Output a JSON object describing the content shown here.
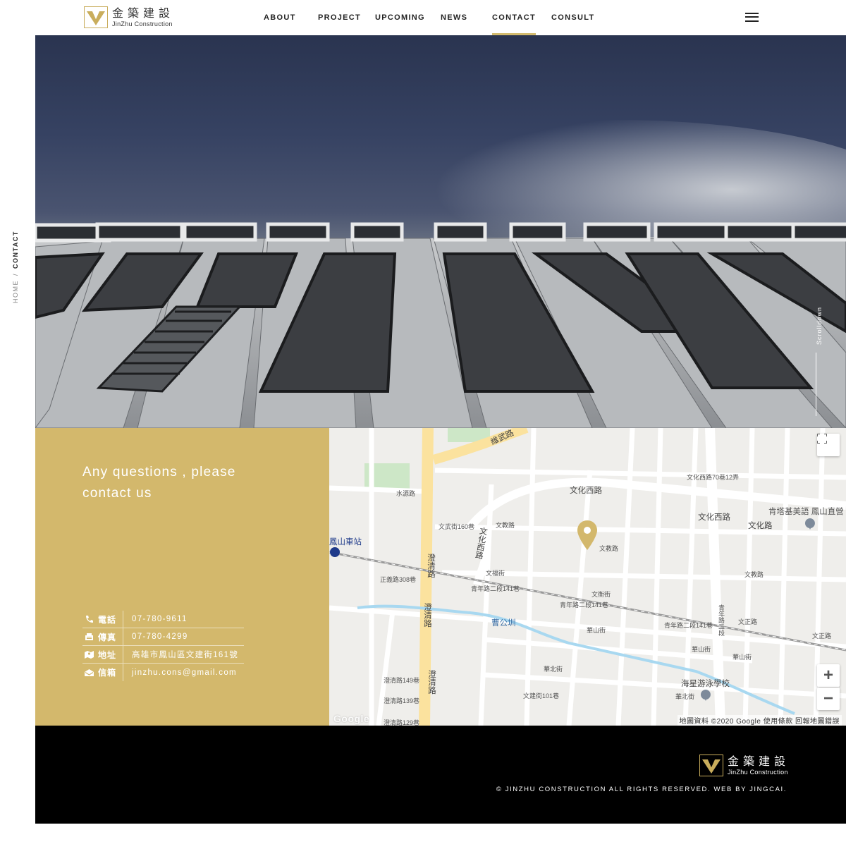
{
  "brand": {
    "name_cn": "金築建設",
    "name_en": "JinZhu Construction",
    "accent_color": "#d3b86c"
  },
  "nav": {
    "items": [
      {
        "label": "ABOUT"
      },
      {
        "label": "PROJECT"
      },
      {
        "label": "UPCOMING"
      },
      {
        "label": "NEWS"
      },
      {
        "label": "CONTACT",
        "active": true
      },
      {
        "label": "CONSULT"
      }
    ],
    "menu_icon": "hamburger-menu-icon"
  },
  "breadcrumb": {
    "home": "HOME",
    "separator": "/",
    "current": "CONTACT"
  },
  "hero": {
    "scrolldown_label": "Scrolldown"
  },
  "contact": {
    "heading": "Any questions , please contact us",
    "rows": [
      {
        "icon": "phone-icon",
        "label": "電話",
        "value": "07-780-9611"
      },
      {
        "icon": "fax-icon",
        "label": "傳真",
        "value": "07-780-4299"
      },
      {
        "icon": "map-icon",
        "label": "地址",
        "value": "高雄市鳳山區文建街161號"
      },
      {
        "icon": "mail-icon",
        "label": "信箱",
        "value": "jinzhu.cons@gmail.com"
      }
    ]
  },
  "map": {
    "labels": {
      "wenhua_w1": "文化西路",
      "wenhua_w2": "文化西路",
      "wenhua_rd": "文化路",
      "wenjiao": "文教路",
      "wenjiao2": "文教路",
      "wenjiao3": "文教路",
      "wenfu": "文福街",
      "wenwu": "文武街160巷",
      "wenhua_70": "文化西路70巷12弄",
      "qingnian": "青年路二段141巷",
      "qingnian2": "青年路二段141巷",
      "qingnian3": "青年路二段141巷",
      "zhengyi": "正義路308巷",
      "chengqing_149": "澄清路149巷",
      "chengqing_139": "澄清路139巷",
      "chengqing_129": "澄清路129巷",
      "shuiyuan": "水源路",
      "huashan": "華山街",
      "huashan2": "華山街",
      "huashan3": "華山街",
      "huabei": "華北街",
      "huabei2": "華北街",
      "wenjian_101": "文建街101巷",
      "wenzheng": "文正路",
      "wenzheng2": "文正路",
      "wenheng": "文衡街",
      "caogongzhen": "曹公圳",
      "station": "鳳山車站",
      "school": "海星游泳學校",
      "english": "肯塔基美語 鳳山直營",
      "weiwu": "維武路",
      "chengqing_v": "澄清路",
      "chengqing_v2": "澄清路",
      "chengqing_v3": "澄清路",
      "wenhua_v": "文化西路",
      "qingnian_v": "青年路二段"
    },
    "attribution": "地圖資料 ©2020 Google   使用條款   回報地圖錯誤",
    "google": "Google",
    "zoom_in": "+",
    "zoom_out": "−",
    "fullscreen_icon": "fullscreen-icon",
    "pin_color": "#d3b86c"
  },
  "footer": {
    "copyright": "© JINZHU CONSTRUCTION ALL RIGHTS RESERVED. WEB BY JINGCAI."
  }
}
